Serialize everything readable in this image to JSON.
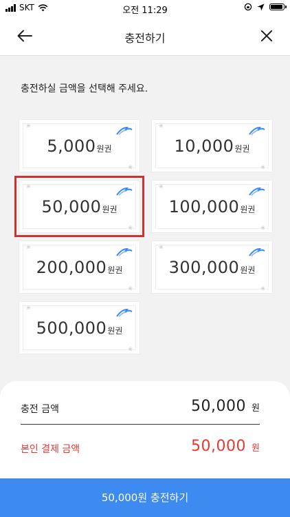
{
  "status_bar": {
    "carrier": "SKT",
    "time": "오전 11:29"
  },
  "header": {
    "title": "충전하기"
  },
  "instruction": "충전하실 금액을 선택해 주세요.",
  "options": [
    {
      "amount": "5,000",
      "unit": "원권"
    },
    {
      "amount": "10,000",
      "unit": "원권"
    },
    {
      "amount": "50,000",
      "unit": "원권",
      "selected": true
    },
    {
      "amount": "100,000",
      "unit": "원권"
    },
    {
      "amount": "200,000",
      "unit": "원권"
    },
    {
      "amount": "300,000",
      "unit": "원권"
    },
    {
      "amount": "500,000",
      "unit": "원권"
    }
  ],
  "summary": {
    "charge_label": "충전 금액",
    "charge_value": "50,000",
    "charge_unit": "원",
    "pay_label": "본인 결제 금액",
    "pay_value": "50,000",
    "pay_unit": "원"
  },
  "cta": {
    "label": "50,000원 충전하기"
  },
  "colors": {
    "accent": "#3d8bf1",
    "selected_border": "#d32f2f",
    "pay_text": "#e53935"
  }
}
